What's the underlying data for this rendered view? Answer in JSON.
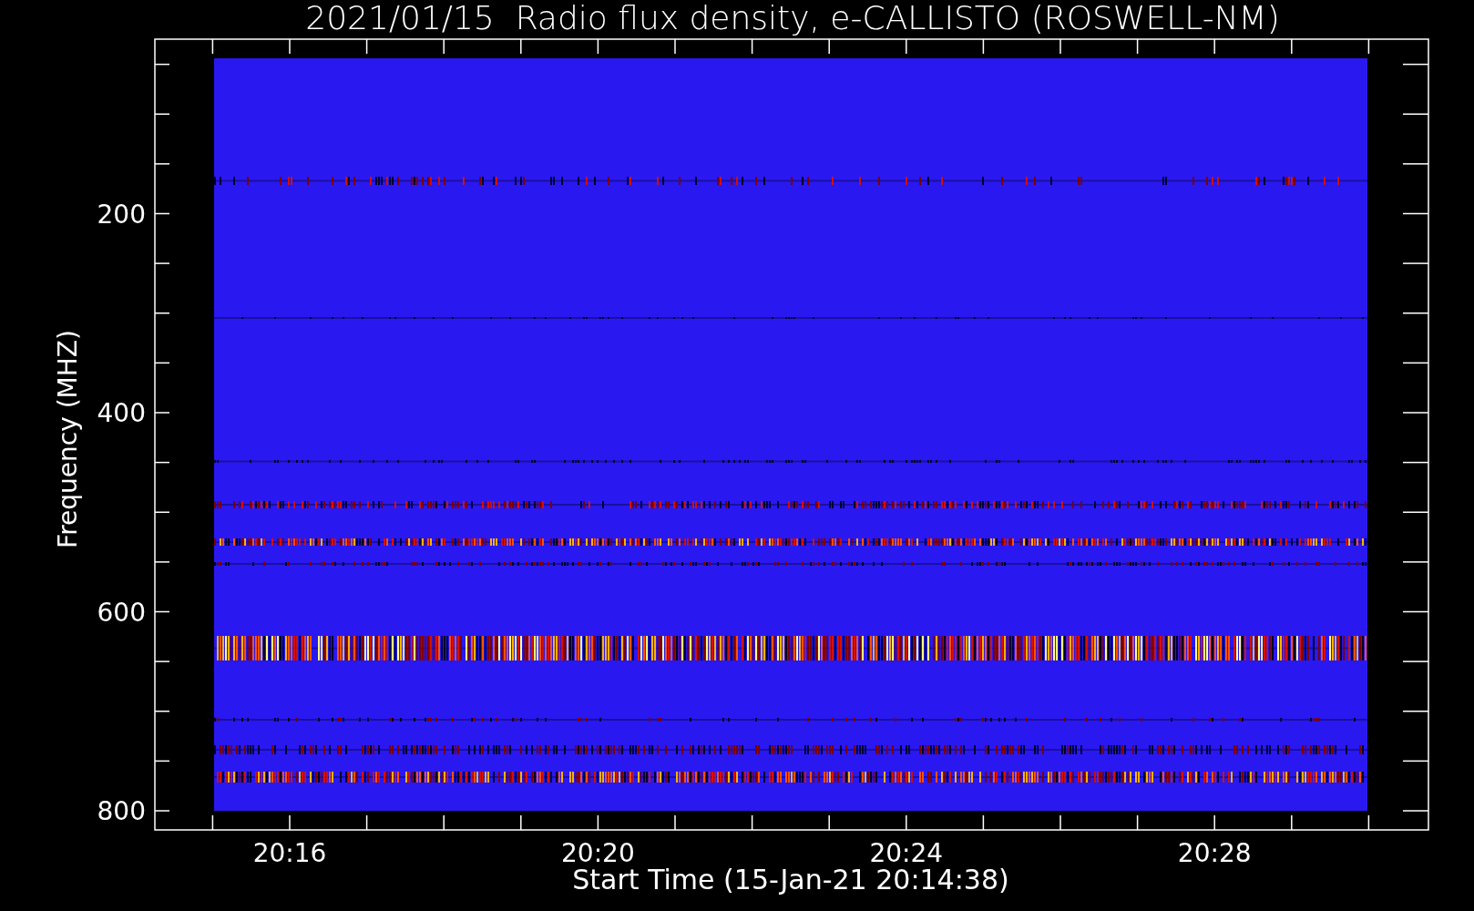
{
  "title": "2021/01/15  Radio flux density, e-CALLISTO (ROSWELL-NM)",
  "y_axis": {
    "label": "Frequency (MHZ)",
    "ticks": [
      "200",
      "400",
      "600",
      "800"
    ]
  },
  "x_axis": {
    "label": "Start Time (15-Jan-21 20:14:38)",
    "ticks": [
      "20:16",
      "20:20",
      "20:24",
      "20:28"
    ]
  }
}
